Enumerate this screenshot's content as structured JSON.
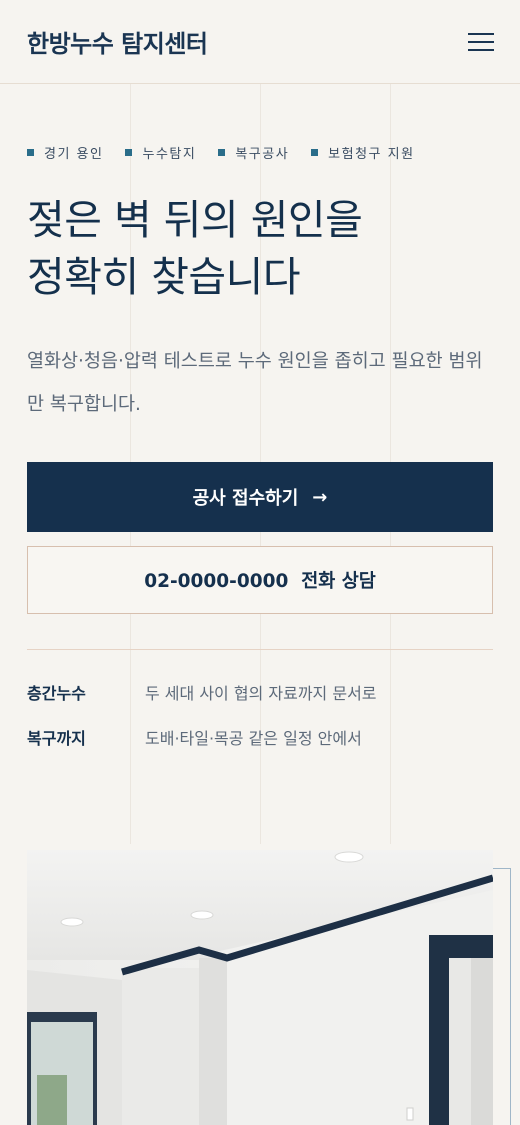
{
  "header": {
    "logo": "한방누수 탐지센터",
    "menu_icon": "hamburger-menu-icon"
  },
  "hero": {
    "tags": [
      "경기 용인",
      "누수탐지",
      "복구공사",
      "보험청구 지원"
    ],
    "headline_line1": "젖은 벽 뒤의 원인을",
    "headline_line2": "정확히 찾습니다",
    "description": "열화상·청음·압력 테스트로 누수 원인을 좁히고 필요한 범위만 복구합니다.",
    "primary_cta": "공사 접수하기",
    "primary_cta_icon": "arrow-right-icon",
    "secondary_cta": "02-0000-0000  전화 상담"
  },
  "info": [
    {
      "label": "층간누수",
      "value": "두 세대 사이 협의 자료까지 문서로"
    },
    {
      "label": "복구까지",
      "value": "도배·타일·목공 같은 일정 안에서"
    }
  ],
  "colors": {
    "navy": "#15304d",
    "accent": "#2a6d8a",
    "background": "#f6f4f0",
    "border": "#d7bfae"
  }
}
